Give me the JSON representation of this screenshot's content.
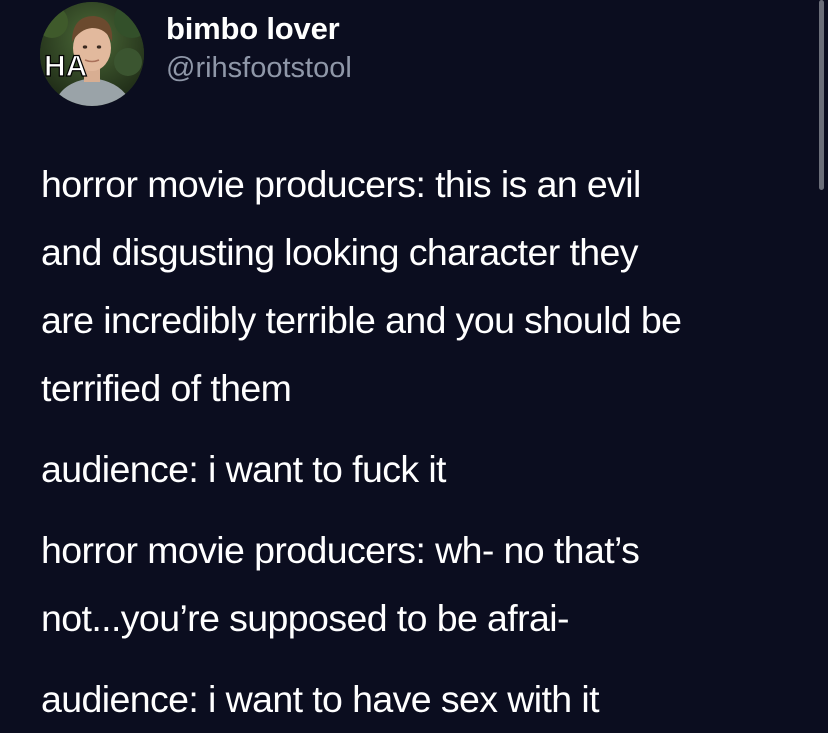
{
  "author": {
    "display_name": "bimbo lover",
    "handle": "@rihsfootstool",
    "avatar_overlay_text": "HA"
  },
  "tweet": {
    "paragraphs": [
      {
        "lines": [
          "horror movie producers: this is an evil",
          "and disgusting looking character they",
          "are incredibly terrible and you should be",
          "terrified of them"
        ]
      },
      {
        "lines": [
          "audience: i want to fuck it"
        ]
      },
      {
        "lines": [
          "horror movie producers: wh- no that’s",
          "not...you’re supposed to be afrai-"
        ]
      },
      {
        "lines": [
          "audience: i want to have sex with it"
        ]
      }
    ]
  },
  "colors": {
    "background": "#0b0d1f",
    "text": "#ffffff",
    "handle": "#8f97a8",
    "scrollbar": "#7d8089"
  }
}
